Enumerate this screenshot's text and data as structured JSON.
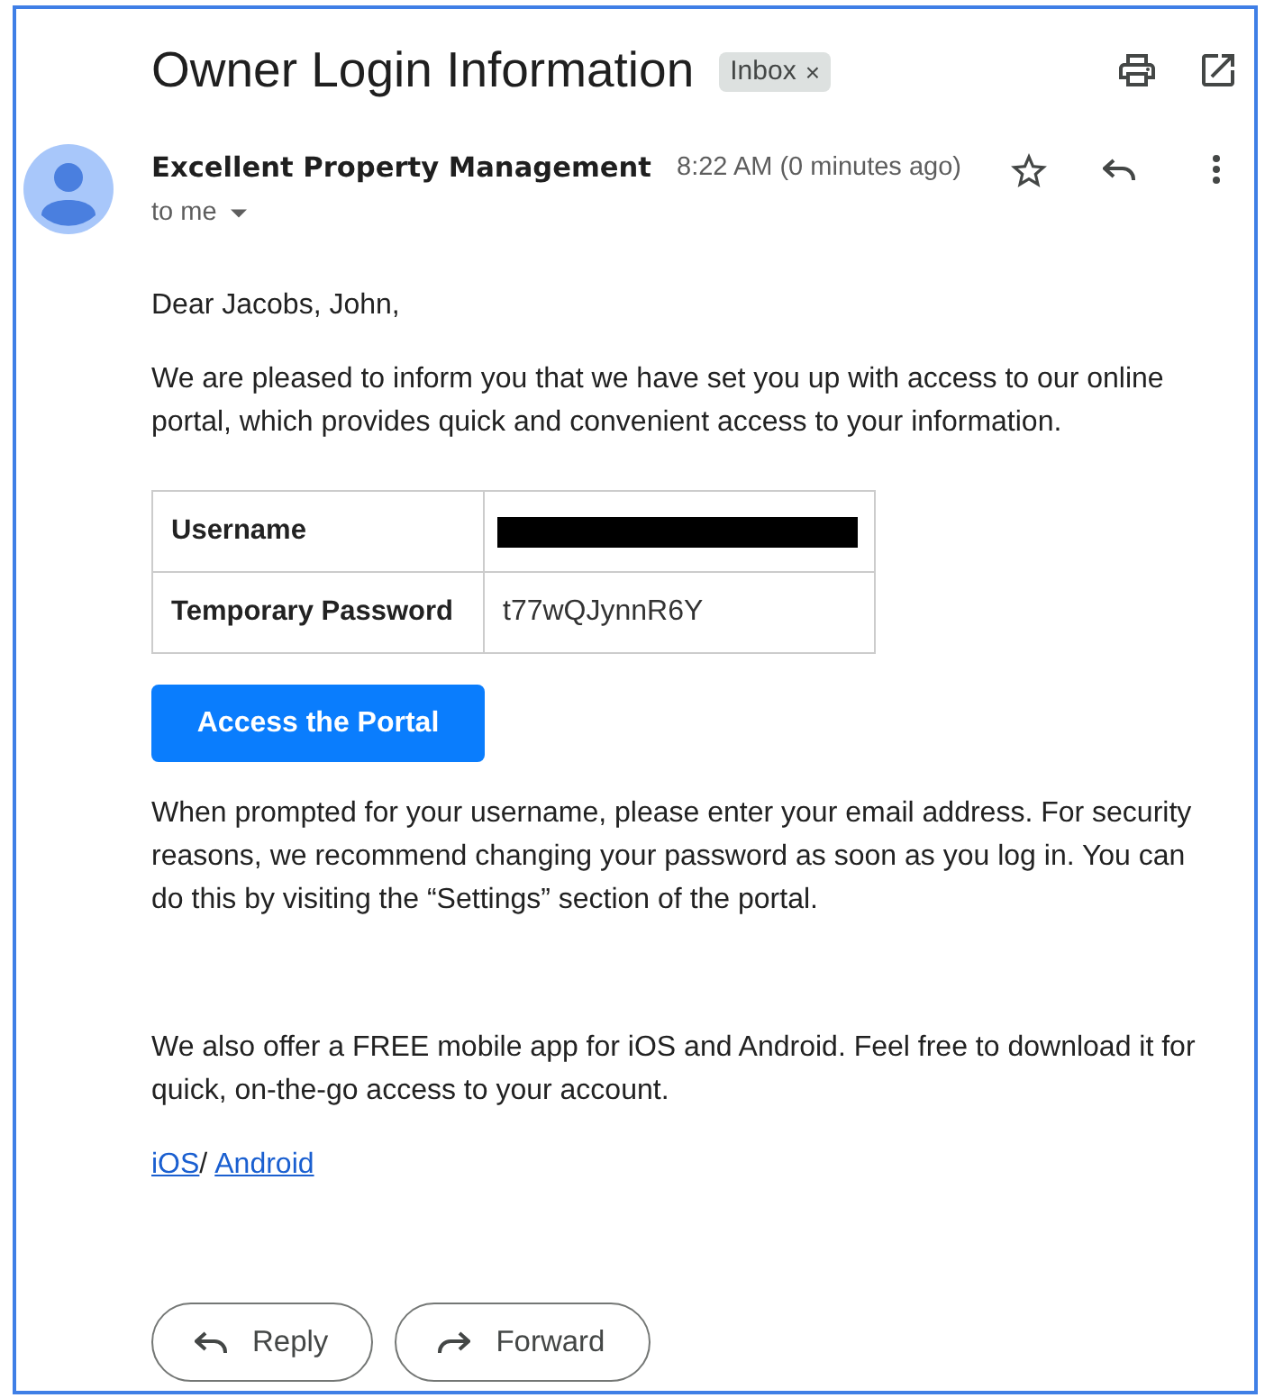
{
  "email": {
    "subject": "Owner Login Information",
    "labels": [
      {
        "text": "Inbox",
        "close": "×"
      }
    ]
  },
  "sender": {
    "name": "Excellent Property Management",
    "time": "8:22 AM (0 minutes ago)",
    "recipient": "to me",
    "starred": false
  },
  "body": {
    "greeting": "Dear Jacobs, John,",
    "intro": "We are pleased to inform you that we have set you up with access to our online portal, which provides quick and convenient access to your information.",
    "credentials": [
      {
        "label": "Username",
        "kind": "redacted"
      },
      {
        "label": "Temporary Password",
        "kind": "text",
        "value": "t77wQJynnR6Y"
      }
    ],
    "portal_button": "Access the Portal",
    "instructions": "When prompted for your username, please enter your email address. For security reasons, we recommend changing your password as soon as you log in. You can do this by visiting the “Settings” section of the portal.",
    "app_note": "We also offer a FREE mobile app for iOS and Android. Feel free to download it for quick, on-the-go access to your account.",
    "app_links": [
      {
        "text": "iOS"
      },
      {
        "text": "Android"
      }
    ],
    "link_separator": "/"
  },
  "actions": [
    {
      "kind": "reply",
      "label": "Reply"
    },
    {
      "kind": "forward",
      "label": "Forward"
    }
  ]
}
